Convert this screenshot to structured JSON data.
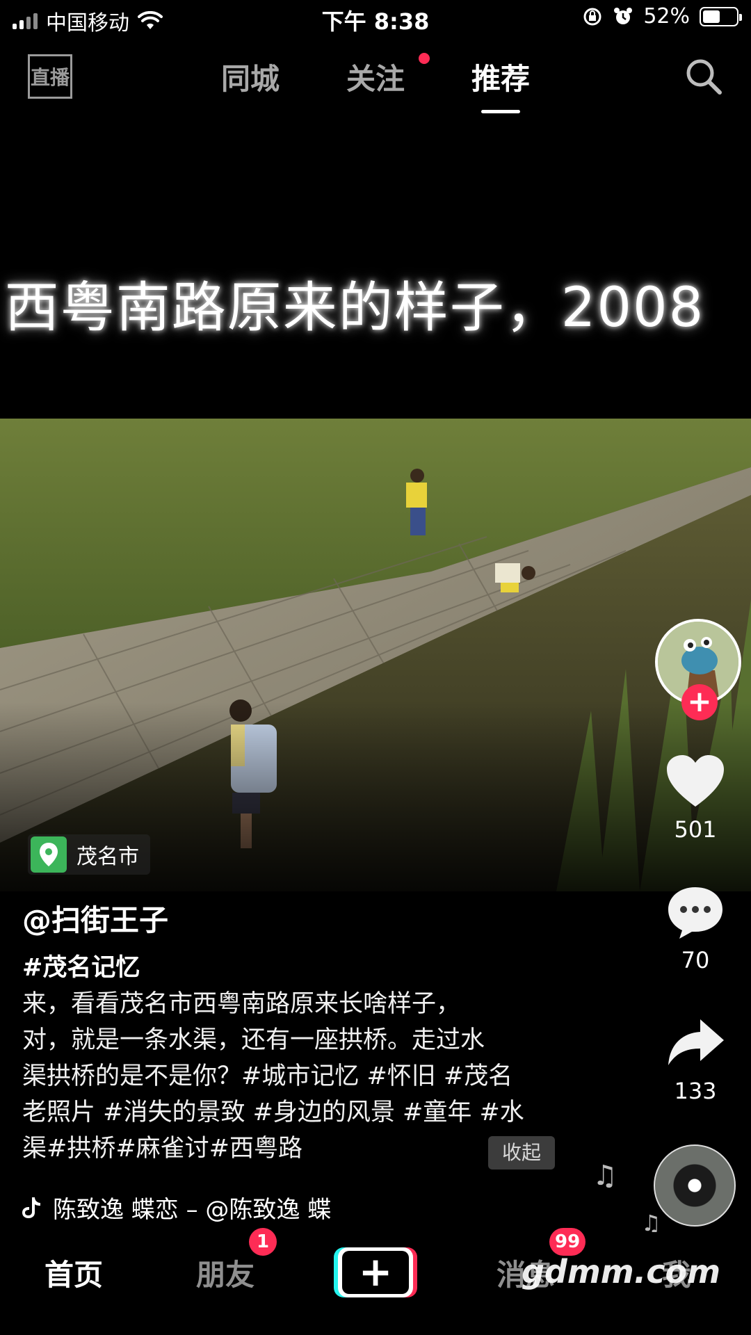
{
  "status_bar": {
    "carrier": "中国移动",
    "time": "下午 8:38",
    "battery": "52%",
    "battery_level": 0.52
  },
  "top_nav": {
    "live_label": "直播",
    "tabs": [
      {
        "label": "同城",
        "active": false
      },
      {
        "label": "关注",
        "active": false,
        "has_dot": true
      },
      {
        "label": "推荐",
        "active": true
      }
    ]
  },
  "video": {
    "title_text": "西粤南路原来的样子，2008"
  },
  "post": {
    "location": "茂名市",
    "username": "@扫街王子",
    "description_lines": [
      "#茂名记忆",
      "来，看看茂名市西粤南路原来长啥样子，",
      "对，就是一条水渠，还有一座拱桥。走过水",
      "渠拱桥的是不是你？#城市记忆 #怀旧 #茂名",
      "老照片 #消失的景致 #身边的风景 #童年 #水",
      "渠#拱桥#麻雀讨#西粤路"
    ],
    "collapse_label": "收起",
    "music_text": "陈致逸    蝶恋 – @陈致逸    蝶"
  },
  "actions": {
    "likes": "501",
    "comments": "70",
    "shares": "133"
  },
  "bottom_nav": {
    "items": [
      {
        "label": "首页",
        "active": true
      },
      {
        "label": "朋友",
        "badge": "1"
      },
      {
        "label": "消息",
        "badge": "99"
      },
      {
        "label": "我"
      }
    ],
    "watermark": "gdmm.com"
  },
  "colors": {
    "accent": "#fe2c55",
    "location_icon": "#3cb55a",
    "cyan": "#25f4ee"
  }
}
